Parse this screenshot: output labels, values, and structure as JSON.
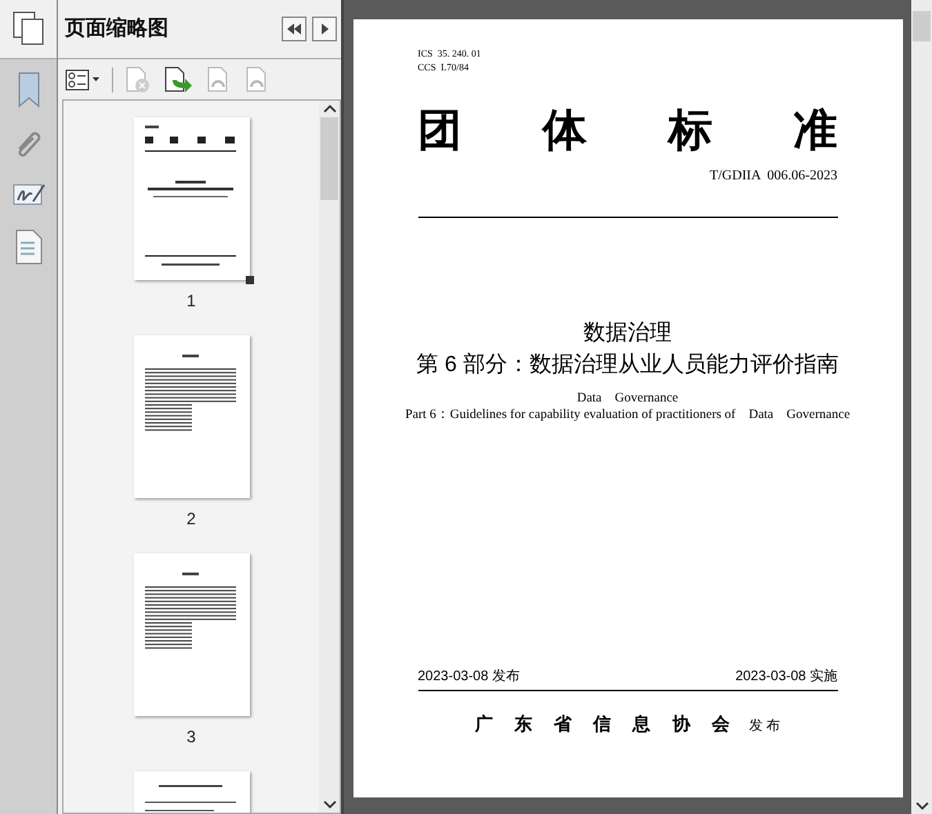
{
  "panel": {
    "title": "页面缩略图"
  },
  "toolbar": [
    {
      "kind": "options",
      "disabled": false
    },
    {
      "kind": "delete",
      "disabled": true
    },
    {
      "kind": "insert",
      "disabled": false
    },
    {
      "kind": "undo",
      "disabled": true
    },
    {
      "kind": "redo",
      "disabled": true
    }
  ],
  "thumbnails": [
    {
      "kind": "cover",
      "label": "1",
      "selected": true
    },
    {
      "kind": "toc",
      "label": "2",
      "selected": false
    },
    {
      "kind": "toc",
      "label": "3",
      "selected": false
    },
    {
      "kind": "text"
    }
  ],
  "document": {
    "ics": "ICS  35. 240. 01",
    "ccs": "CCS  L70/84",
    "heading": [
      "团",
      "体",
      "标",
      "准"
    ],
    "code": "T/GDIIA  006.06-2023",
    "title": "数据治理",
    "subtitle": "第 6 部分：数据治理从业人员能力评价指南",
    "english_title": "Data    Governance",
    "english_subtitle": "Part 6：Guidelines for capability evaluation of practitioners of    Data    Governance",
    "issue_date": "2023-03-08 发布",
    "effective_date": "2023-03-08 实施",
    "publisher": "广 东 省 信 息 协 会",
    "publisher_suffix": "发 布"
  }
}
